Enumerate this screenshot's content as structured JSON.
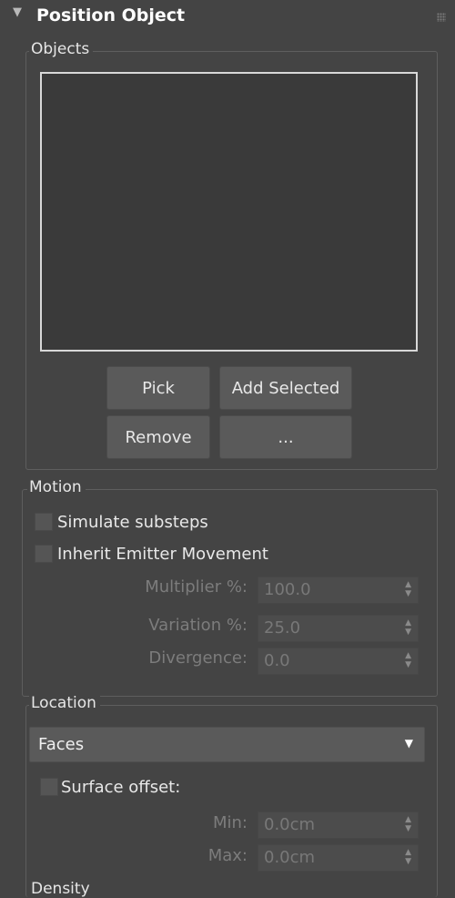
{
  "rollout": {
    "title": "Position Object",
    "collapse_icon": "triangle-down-icon"
  },
  "objects": {
    "legend": "Objects",
    "items": [],
    "buttons": {
      "pick": "Pick",
      "add_selected": "Add Selected",
      "remove": "Remove",
      "more": "..."
    }
  },
  "motion": {
    "legend": "Motion",
    "simulate_substeps": {
      "label": "Simulate substeps",
      "checked": false
    },
    "inherit_emitter_movement": {
      "label": "Inherit Emitter Movement",
      "checked": false
    },
    "multiplier": {
      "label": "Multiplier %:",
      "value": "100.0"
    },
    "variation": {
      "label": "Variation %:",
      "value": "25.0"
    },
    "divergence": {
      "label": "Divergence:",
      "value": "0.0"
    }
  },
  "location": {
    "legend": "Location",
    "dropdown_value": "Faces",
    "surface_offset": {
      "label": "Surface offset:",
      "checked": false
    },
    "min": {
      "label": "Min:",
      "value": "0.0cm"
    },
    "max": {
      "label": "Max:",
      "value": "0.0cm"
    },
    "next_group_label": "Density"
  },
  "colors": {
    "background": "#444444",
    "field": "#4c4c4c",
    "button": "#5a5a5a",
    "list_border": "#d8d8d8"
  }
}
